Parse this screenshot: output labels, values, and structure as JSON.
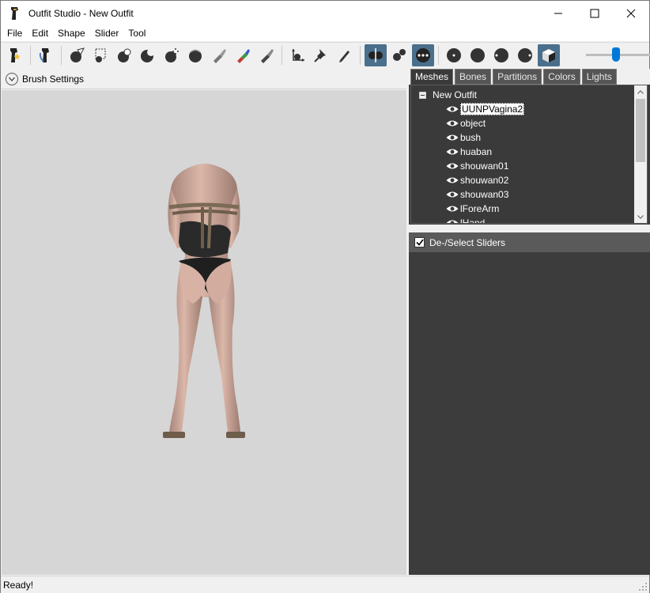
{
  "window": {
    "title": "Outfit Studio - New Outfit",
    "controls": {
      "minimize": "minimize",
      "maximize": "maximize",
      "close": "close"
    }
  },
  "menu": [
    "File",
    "Edit",
    "Shape",
    "Slider",
    "Tool"
  ],
  "brush_settings": {
    "label": "Brush Settings"
  },
  "tabs": [
    "Meshes",
    "Bones",
    "Partitions",
    "Colors",
    "Lights"
  ],
  "active_tab": "Meshes",
  "tree": {
    "root": "New Outfit",
    "items": [
      "UUNPVagina2",
      "object",
      "bush",
      "huaban",
      "shouwan01",
      "shouwan02",
      "shouwan03",
      "lForeArm",
      "lHand"
    ],
    "selected": "UUNPVagina2"
  },
  "sliders_panel": {
    "label": "De-/Select Sliders",
    "checked": true
  },
  "status": {
    "text": "Ready!"
  },
  "toolbar": {
    "brush_size_level": 0.43
  },
  "colors": {
    "accent": "#0078d7",
    "panel_dark": "#3c3c3c",
    "viewport": "#d6d6d6",
    "active_tool": "#4a6f8c"
  }
}
